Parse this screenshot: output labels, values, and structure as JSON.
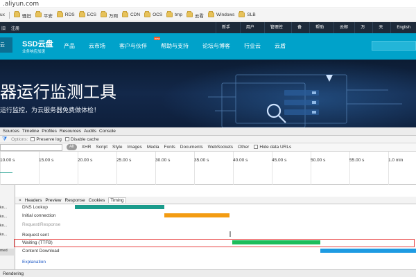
{
  "browser": {
    "url": ".aliyun.com",
    "bookmarks": [
      "ux",
      "骚旧",
      "平安",
      "RDS",
      "ECS",
      "万网",
      "CDN",
      "OCS",
      "tmp",
      "云看",
      "Windows",
      "SLB"
    ]
  },
  "site": {
    "topstrip": {
      "left_links": [
        "旧",
        "注册"
      ],
      "right_links": [
        "新手专区",
        "用户中心",
        "管理控制台",
        "备案",
        "帮助中心",
        "云邮箱",
        "万网",
        "天池",
        "English"
      ]
    },
    "logo_text": "云",
    "product": "SSD云盘",
    "product_sub": "业务响应加速",
    "nav_items": [
      "产品",
      "云市场",
      "客户与伙伴",
      "帮助与支持",
      "论坛与博客",
      "行业云",
      "云盾"
    ],
    "new_badge": "new",
    "banner_title": "器运行监测工具",
    "banner_subtitle": "运行监控，为云服务器免费做体检！"
  },
  "devtools": {
    "tabs": [
      "Sources",
      "Timeline",
      "Profiles",
      "Resources",
      "Audits",
      "Console"
    ],
    "options_label": "Options:",
    "preserve_log": "Preserve log",
    "disable_cache": "Disable cache",
    "filter_all": "All",
    "filter_types": [
      "XHR",
      "Script",
      "Style",
      "Images",
      "Media",
      "Fonts",
      "Documents",
      "WebSockets",
      "Other"
    ],
    "hide_data_urls": "Hide data URLs",
    "overview_ticks": [
      "10.00 s",
      "15.00 s",
      "20.00 s",
      "25.00 s",
      "30.00 s",
      "35.00 s",
      "40.00 s",
      "45.00 s",
      "50.00 s",
      "55.00 s",
      "1.0 min"
    ],
    "request_names": [
      "kn...",
      "kn...",
      "kn...",
      "kn...",
      "med"
    ],
    "detail_tabs": [
      "×",
      "Headers",
      "Preview",
      "Response",
      "Cookies",
      "Timing"
    ],
    "timing_rows": {
      "dns": "DNS Lookup",
      "initial": "Initial connection",
      "section": "Request/Response",
      "sent": "Request sent",
      "waiting": "Waiting (TTFB)",
      "download": "Content Download"
    },
    "explanation": "Explanation",
    "status_tabs": [
      "Rendering"
    ],
    "colors": {
      "dns": "#1a9c8c",
      "initial": "#f39c12",
      "waiting": "#1ebd5b",
      "download": "#1e9be2",
      "highlight": "#e84040"
    }
  }
}
